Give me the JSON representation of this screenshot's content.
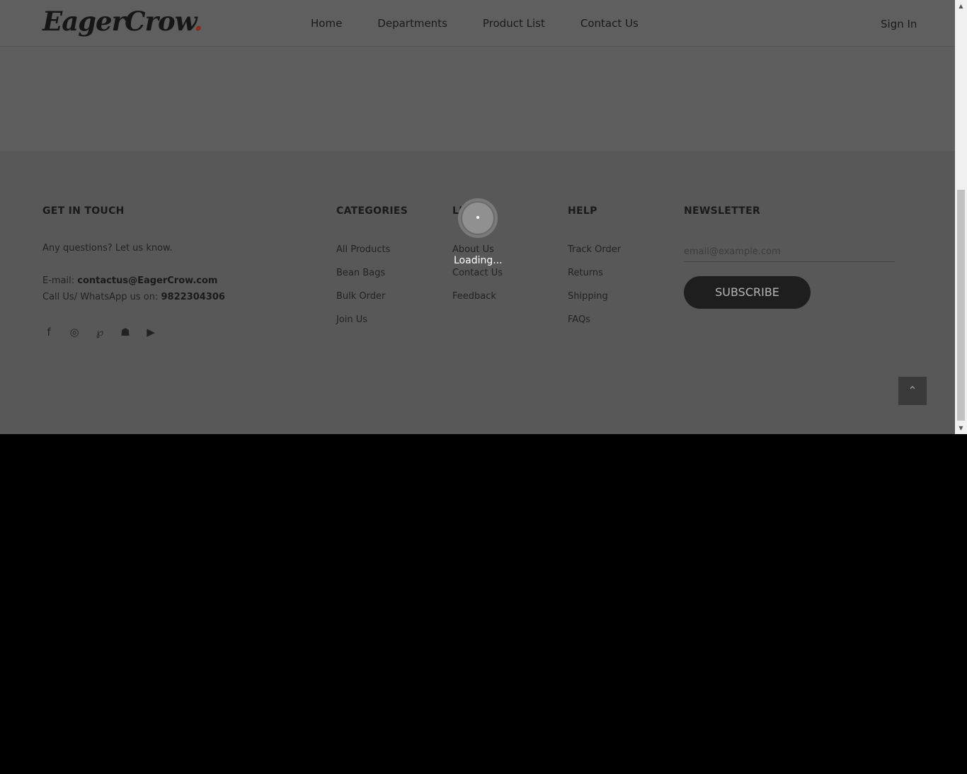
{
  "header": {
    "logo": "EagerCrow",
    "logo_dot": ".",
    "nav": [
      "Home",
      "Departments",
      "Product List",
      "Contact Us"
    ],
    "sign_in": "Sign In"
  },
  "footer": {
    "get_in_touch": {
      "title": "GET IN TOUCH",
      "question": "Any questions? Let us know.",
      "email_label": "E-mail: ",
      "email": "contactus@EagerCrow.com",
      "phone_label": "Call Us/ WhatsApp us on: ",
      "phone": "9822304306",
      "social_icons": [
        "facebook-icon",
        "instagram-icon",
        "pinterest-icon",
        "snapchat-icon",
        "youtube-icon"
      ]
    },
    "categories": {
      "title": "CATEGORIES",
      "items": [
        "All Products",
        "Bean Bags",
        "Bulk Order",
        "Join Us"
      ]
    },
    "links": {
      "title": "LINKS",
      "items": [
        "About Us",
        "Contact Us",
        "Feedback"
      ]
    },
    "help": {
      "title": "HELP",
      "items": [
        "Track Order",
        "Returns",
        "Shipping",
        "FAQs"
      ]
    },
    "newsletter": {
      "title": "NEWSLETTER",
      "placeholder": "email@example.com",
      "button": "SUBSCRIBE"
    }
  },
  "loading": {
    "text": "Loading..."
  },
  "colors": {
    "overlay_bg": "#5e5e5e",
    "button_dark": "#1e1e1e",
    "logo_dot": "#8a2a1a"
  }
}
